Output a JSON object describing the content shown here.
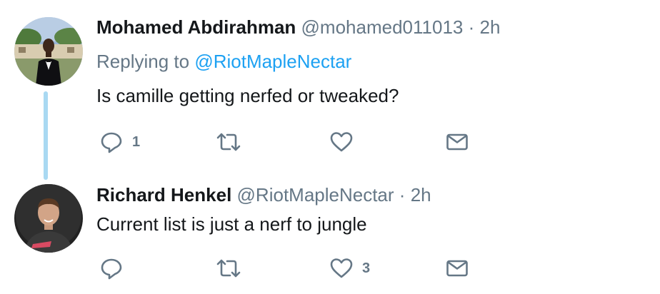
{
  "thread": [
    {
      "author": {
        "name": "Mohamed Abdirahman",
        "handle": "@mohamed011013"
      },
      "separator": "·",
      "time": "2h",
      "replying": {
        "prefix": "Replying to",
        "handle": "@RiotMapleNectar"
      },
      "text": "Is camille getting nerfed or tweaked?",
      "stats": {
        "replies": "1",
        "retweets": "",
        "likes": ""
      }
    },
    {
      "author": {
        "name": "Richard Henkel",
        "handle": "@RiotMapleNectar"
      },
      "separator": "·",
      "time": "2h",
      "text": "Current list is just a nerf to jungle",
      "stats": {
        "replies": "",
        "retweets": "",
        "likes": "3"
      }
    }
  ],
  "colors": {
    "name": "#14171a",
    "muted": "#657786",
    "link": "#1da1f2",
    "thread_line": "#a9d9f2"
  },
  "icons": [
    "reply-icon",
    "retweet-icon",
    "like-icon",
    "direct-message-icon"
  ]
}
